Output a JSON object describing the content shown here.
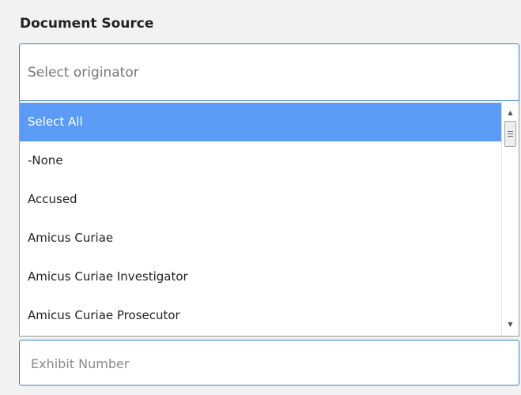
{
  "document_source": {
    "label": "Document Source",
    "originator_select": {
      "placeholder": "Select originator"
    },
    "options": [
      {
        "label": "Select All",
        "highlighted": true
      },
      {
        "label": "-None",
        "highlighted": false
      },
      {
        "label": "Accused",
        "highlighted": false
      },
      {
        "label": "Amicus Curiae",
        "highlighted": false
      },
      {
        "label": "Amicus Curiae Investigator",
        "highlighted": false
      },
      {
        "label": "Amicus Curiae Prosecutor",
        "highlighted": false
      }
    ],
    "scrollbar": {
      "up_icon": "triangle-up",
      "down_icon": "triangle-down"
    }
  },
  "exhibit_number": {
    "placeholder": "Exhibit Number"
  },
  "colors": {
    "highlight": "#5b9bf5",
    "input_border": "#3b7fc4",
    "panel_background": "#f2f2f2"
  }
}
